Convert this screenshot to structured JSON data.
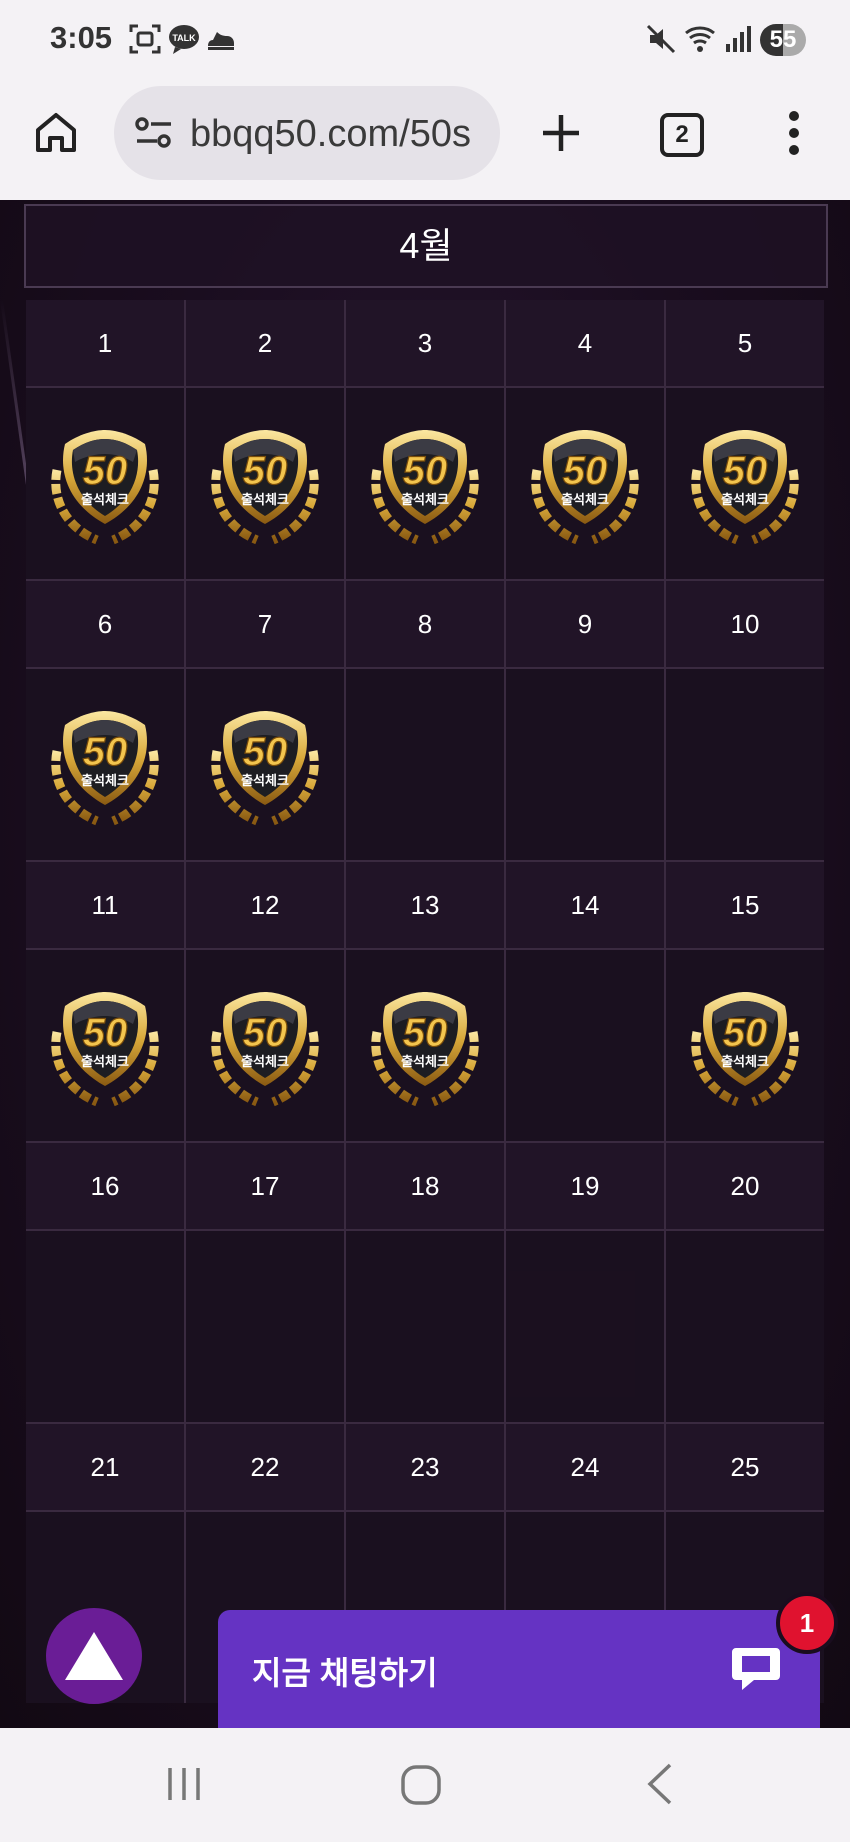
{
  "status_bar": {
    "time": "3:05",
    "battery": "55",
    "talk_label": "TALK"
  },
  "browser": {
    "url": "bbqq50.com/50s",
    "tab_count": "2"
  },
  "calendar": {
    "month": "4월",
    "badge_number": "50",
    "badge_label": "출석체크",
    "weeks": [
      {
        "days": [
          {
            "day": "1",
            "checked": true
          },
          {
            "day": "2",
            "checked": true
          },
          {
            "day": "3",
            "checked": true
          },
          {
            "day": "4",
            "checked": true
          },
          {
            "day": "5",
            "checked": true
          }
        ]
      },
      {
        "days": [
          {
            "day": "6",
            "checked": true
          },
          {
            "day": "7",
            "checked": true
          },
          {
            "day": "8",
            "checked": false
          },
          {
            "day": "9",
            "checked": false
          },
          {
            "day": "10",
            "checked": false
          }
        ]
      },
      {
        "days": [
          {
            "day": "11",
            "checked": true
          },
          {
            "day": "12",
            "checked": true
          },
          {
            "day": "13",
            "checked": true
          },
          {
            "day": "14",
            "checked": false
          },
          {
            "day": "15",
            "checked": true
          }
        ]
      },
      {
        "days": [
          {
            "day": "16",
            "checked": false
          },
          {
            "day": "17",
            "checked": false
          },
          {
            "day": "18",
            "checked": false
          },
          {
            "day": "19",
            "checked": false
          },
          {
            "day": "20",
            "checked": false
          }
        ]
      },
      {
        "days": [
          {
            "day": "21",
            "checked": false
          },
          {
            "day": "22",
            "checked": false
          },
          {
            "day": "23",
            "checked": false
          },
          {
            "day": "24",
            "checked": false
          },
          {
            "day": "25",
            "checked": false
          }
        ]
      }
    ]
  },
  "chat_widget": {
    "label": "지금 채팅하기",
    "unread": "1"
  },
  "colors": {
    "chat": "#6533c3",
    "scroll_top": "#6a1d96",
    "unread_badge": "#e0122f",
    "gold": "#d9a93a"
  }
}
